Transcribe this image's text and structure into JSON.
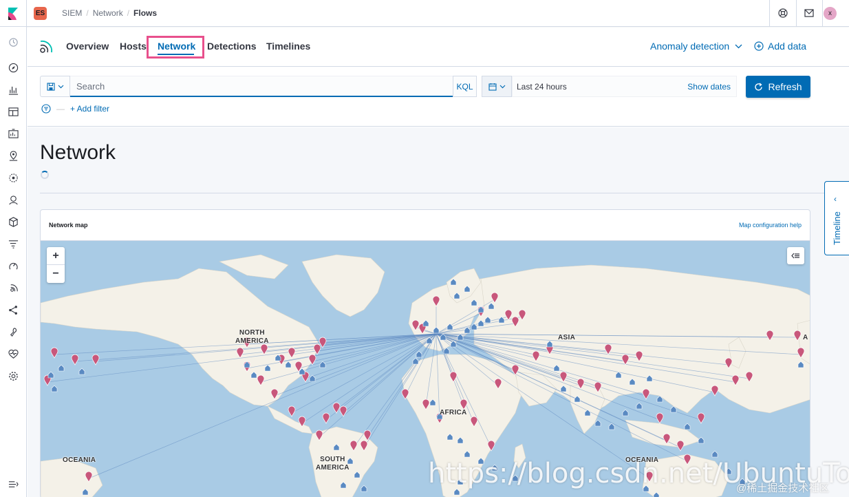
{
  "header": {
    "space_badge": "ES",
    "breadcrumbs": [
      "SIEM",
      "Network",
      "Flows"
    ],
    "breadcrumb_separator": "/",
    "avatar_initial": "x",
    "icons": [
      "help-icon",
      "mail-icon"
    ]
  },
  "sidenav": {
    "icons": [
      "recent-icon",
      "discover-icon",
      "visualize-icon",
      "dashboard-icon",
      "canvas-icon",
      "maps-icon",
      "ml-icon",
      "metrics-icon",
      "logs-icon",
      "apm-icon",
      "uptime-icon",
      "siem-icon",
      "graph-icon",
      "devtools-icon",
      "monitoring-icon",
      "management-icon",
      "collapse-icon"
    ]
  },
  "tabs": {
    "items": [
      "Overview",
      "Hosts",
      "Network",
      "Detections",
      "Timelines"
    ],
    "active": "Network",
    "anomaly_label": "Anomaly detection",
    "add_data_label": "Add data"
  },
  "query": {
    "placeholder": "Search",
    "language": "KQL",
    "date_label": "Last 24 hours",
    "show_dates": "Show dates",
    "refresh_label": "Refresh",
    "add_filter": "+ Add filter"
  },
  "page": {
    "title": "Network"
  },
  "panel": {
    "title": "Network map",
    "help_link": "Map configuration help",
    "zoom_in": "+",
    "zoom_out": "−",
    "layer_toggle": "⋯",
    "labels": {
      "north_america_1": "NORTH",
      "north_america_2": "AMERICA",
      "south_america_1": "SOUTH",
      "south_america_2": "AMERICA",
      "africa": "AFRICA",
      "asia": "ASIA",
      "oceania_left": "OCEANIA",
      "oceania_right": "OCEANIA",
      "asia_edge": "A"
    },
    "colors": {
      "ocean": "#a9cbe5",
      "land": "#f4f1e8",
      "destination_pin": "#c8577b",
      "source_icon": "#5a8ac2",
      "flow_line": "#5b86c0"
    }
  },
  "timeline": {
    "label": "Timeline"
  },
  "watermark": {
    "url": "https://blog.csdn.net/UbuntuTou",
    "community": "@稀土掘金技术社区"
  }
}
